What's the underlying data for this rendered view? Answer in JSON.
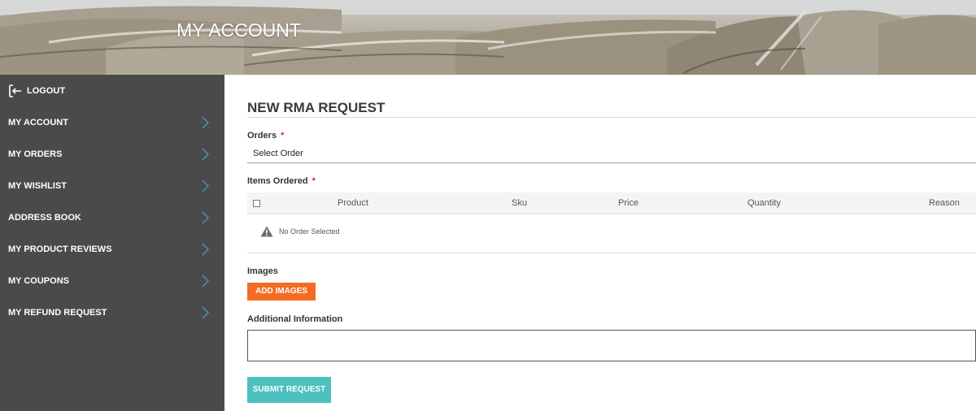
{
  "banner": {
    "title": "MY ACCOUNT"
  },
  "sidebar": {
    "logout": {
      "label": "LOGOUT",
      "icon": "logout-icon"
    },
    "items": [
      {
        "label": "MY ACCOUNT"
      },
      {
        "label": "MY ORDERS"
      },
      {
        "label": "MY WISHLIST"
      },
      {
        "label": "ADDRESS BOOK"
      },
      {
        "label": "MY PRODUCT REVIEWS"
      },
      {
        "label": "MY COUPONS"
      },
      {
        "label": "MY REFUND REQUEST"
      }
    ],
    "chevron_icon": "chevron-right-icon",
    "chevron_color": "#3fa6ad"
  },
  "form": {
    "title": "NEW RMA REQUEST",
    "orders_label": "Orders",
    "required_mark": "*",
    "orders_select_value": "Select Order",
    "items_label": "Items Ordered",
    "table": {
      "columns": [
        "Product",
        "Sku",
        "Price",
        "Quantity",
        "Reason"
      ],
      "empty_message": "No Order Selected",
      "empty_icon": "warning-icon"
    },
    "images_label": "Images",
    "add_images_button": "ADD IMAGES",
    "additional_info_label": "Additional Information",
    "submit_button": "SUBMIT REQUEST"
  },
  "colors": {
    "sidebar_bg": "#4a4a4a",
    "orange_button": "#f26c24",
    "teal_button": "#4dbfbf",
    "required": "#e02b27"
  }
}
